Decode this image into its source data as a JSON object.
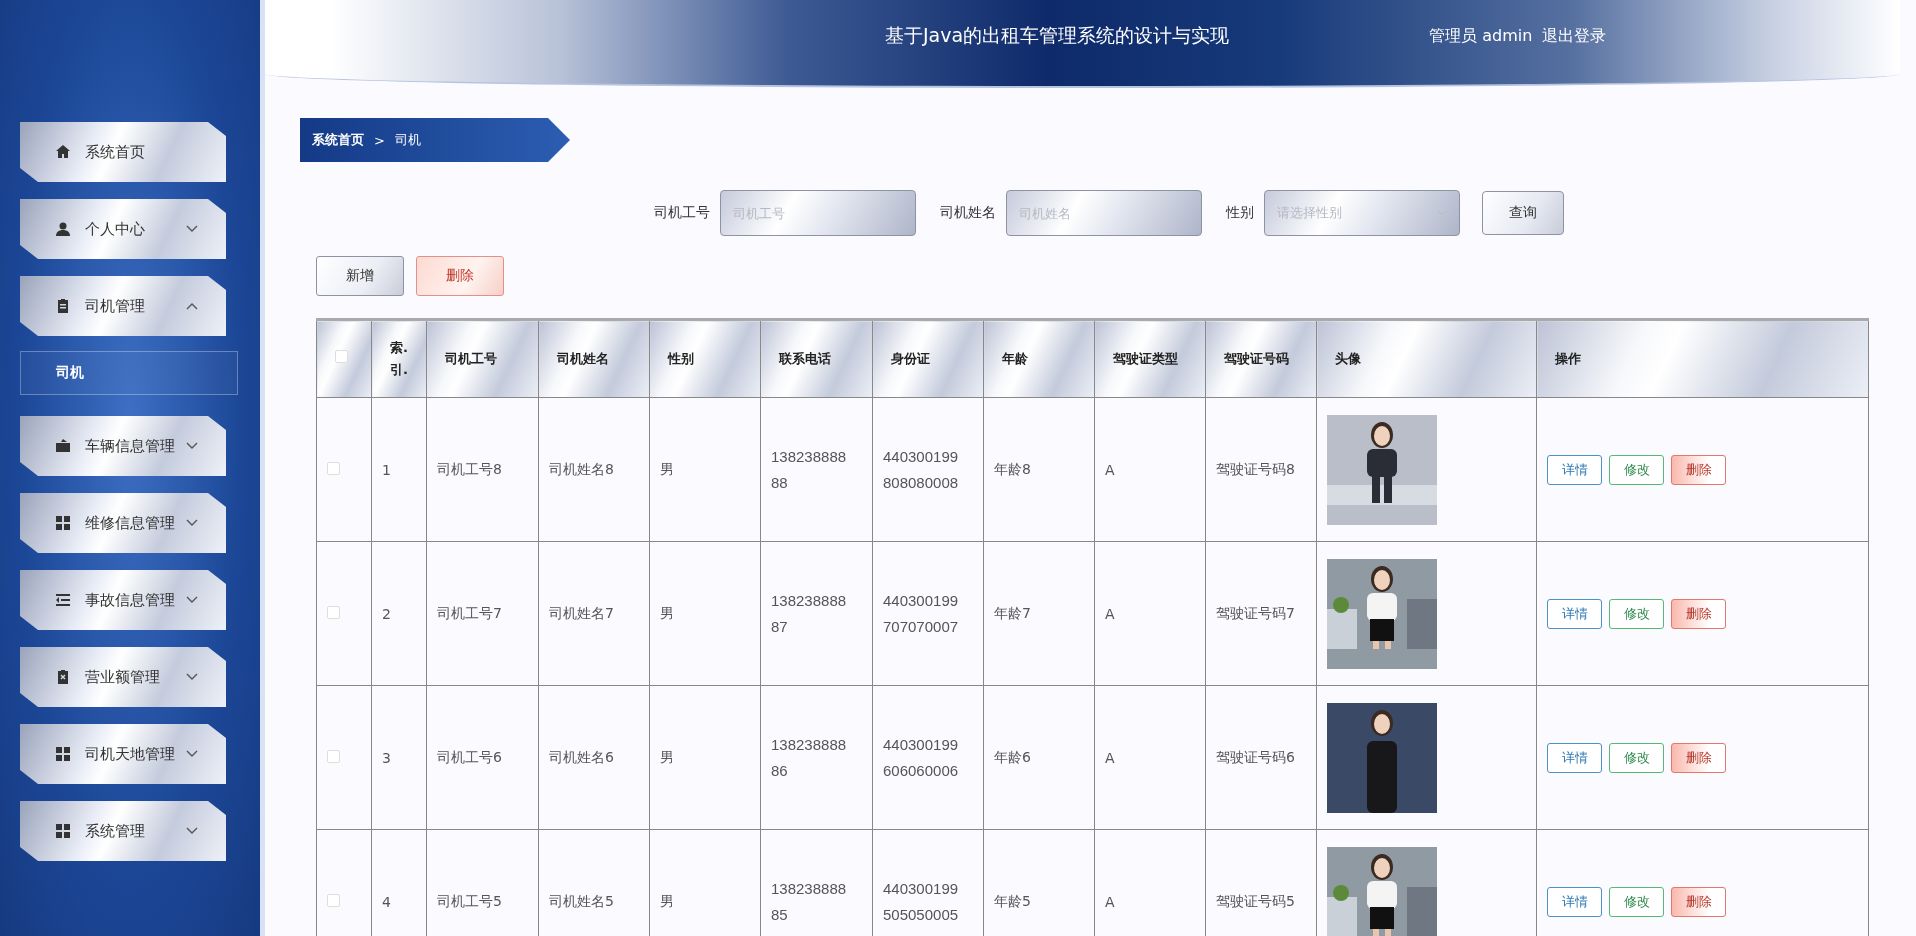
{
  "header": {
    "title": "基于Java的出租车管理系统的设计与实现",
    "user": "管理员 admin",
    "logout": "退出登录"
  },
  "sidebar": {
    "items": [
      {
        "label": "系统首页"
      },
      {
        "label": "个人中心",
        "expanded": false
      },
      {
        "label": "司机管理",
        "expanded": true,
        "children": [
          {
            "label": "司机",
            "selected": true
          }
        ]
      },
      {
        "label": "车辆信息管理",
        "expanded": false
      },
      {
        "label": "维修信息管理",
        "expanded": false
      },
      {
        "label": "事故信息管理",
        "expanded": false
      },
      {
        "label": "营业额管理",
        "expanded": false
      },
      {
        "label": "司机天地管理",
        "expanded": false
      },
      {
        "label": "系统管理",
        "expanded": false
      }
    ]
  },
  "breadcrumb": {
    "items": [
      "系统首页",
      "司机"
    ],
    "separator": ">"
  },
  "search": {
    "fields": [
      {
        "kind": "input",
        "label": "司机工号",
        "placeholder": "司机工号"
      },
      {
        "kind": "input",
        "label": "司机姓名",
        "placeholder": "司机姓名"
      },
      {
        "kind": "select",
        "label": "性别",
        "placeholder": "请选择性别"
      }
    ],
    "button": "查询"
  },
  "actions": [
    {
      "kind": "default",
      "label": "新增"
    },
    {
      "kind": "danger",
      "label": "删除"
    }
  ],
  "table": {
    "select_all": false,
    "columns": [
      "索.引.",
      "司机工号",
      "司机姓名",
      "性别",
      "联系电话",
      "身份证",
      "年龄",
      "驾驶证类型",
      "驾驶证号码",
      "头像",
      "操作"
    ],
    "rows": [
      {
        "checked": false,
        "cells": [
          "1",
          "司机工号8",
          "司机姓名8",
          "男",
          "13823888888",
          "440300199808080008",
          "年龄8",
          "A",
          "驾驶证号码8"
        ],
        "photo": {
          "kind": "picture"
        },
        "actions": [
          {
            "kind": "detail",
            "label": "详情"
          },
          {
            "kind": "edit",
            "label": "修改"
          },
          {
            "kind": "delete",
            "label": "删除"
          }
        ]
      },
      {
        "checked": false,
        "cells": [
          "2",
          "司机工号7",
          "司机姓名7",
          "男",
          "13823888887",
          "440300199707070007",
          "年龄7",
          "A",
          "驾驶证号码7"
        ],
        "photo": {
          "kind": "picture"
        },
        "actions": [
          {
            "kind": "detail",
            "label": "详情"
          },
          {
            "kind": "edit",
            "label": "修改"
          },
          {
            "kind": "delete",
            "label": "删除"
          }
        ]
      },
      {
        "checked": false,
        "cells": [
          "3",
          "司机工号6",
          "司机姓名6",
          "男",
          "13823888886",
          "440300199606060006",
          "年龄6",
          "A",
          "驾驶证号码6"
        ],
        "photo": {
          "kind": "picture"
        },
        "actions": [
          {
            "kind": "detail",
            "label": "详情"
          },
          {
            "kind": "edit",
            "label": "修改"
          },
          {
            "kind": "delete",
            "label": "删除"
          }
        ]
      },
      {
        "checked": false,
        "cells": [
          "4",
          "司机工号5",
          "司机姓名5",
          "男",
          "13823888885",
          "440300199505050005",
          "年龄5",
          "A",
          "驾驶证号码5"
        ],
        "photo": {
          "kind": "picture"
        },
        "actions": [
          {
            "kind": "detail",
            "label": "详情"
          },
          {
            "kind": "edit",
            "label": "修改"
          },
          {
            "kind": "delete",
            "label": "删除"
          }
        ]
      }
    ]
  }
}
